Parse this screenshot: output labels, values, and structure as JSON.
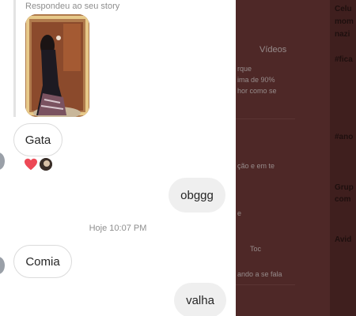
{
  "story": {
    "caption": "Respondeu ao seu story"
  },
  "messages": [
    {
      "from": "them",
      "text": "Gata"
    },
    {
      "from": "me",
      "text": "obggg"
    },
    {
      "from": "them",
      "text": "Comia"
    },
    {
      "from": "me",
      "text": "valha"
    }
  ],
  "timestamp": "Hoje 10:07 PM",
  "background_fragments": {
    "videos": "Vídeos",
    "frag1": "rque",
    "frag2": "ima de 90%",
    "frag3": "hor como se",
    "frag4": "ção e em te",
    "frag5": "e",
    "frag6": "Toc",
    "frag7": "ando a se fala"
  },
  "side_panel": {
    "items": [
      "Celu",
      "mom",
      "nazi",
      "#fica",
      "#ano",
      "Grup",
      "com",
      "Avid"
    ]
  },
  "colors": {
    "overlay": "#4e2827",
    "heart": "#ed4956",
    "bubble_out": "#efefef"
  }
}
